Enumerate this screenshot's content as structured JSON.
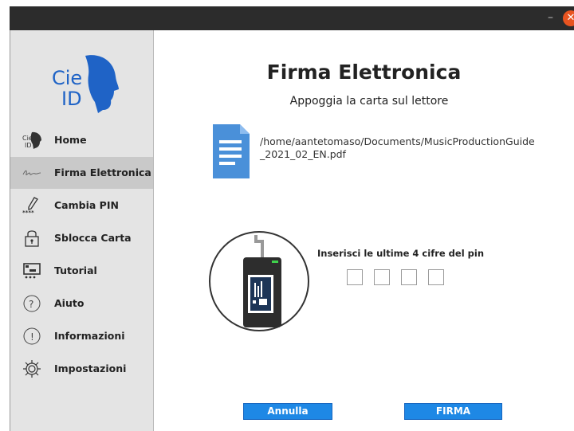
{
  "window": {
    "minimize_label": "–",
    "close_label": "✕"
  },
  "logo": {
    "line1": "Cie",
    "line2": "ID",
    "brand_color": "#1f63c6"
  },
  "sidebar": {
    "items": [
      {
        "label": "Home",
        "icon": "cie-id-icon",
        "active": false
      },
      {
        "label": "Firma Elettronica",
        "icon": "signature-icon",
        "active": true
      },
      {
        "label": "Cambia PIN",
        "icon": "pen-pin-icon",
        "active": false
      },
      {
        "label": "Sblocca Carta",
        "icon": "padlock-icon",
        "active": false
      },
      {
        "label": "Tutorial",
        "icon": "tutorial-icon",
        "active": false
      },
      {
        "label": "Aiuto",
        "icon": "question-icon",
        "active": false
      },
      {
        "label": "Informazioni",
        "icon": "exclamation-icon",
        "active": false
      },
      {
        "label": "Impostazioni",
        "icon": "gear-icon",
        "active": false
      }
    ]
  },
  "main": {
    "title": "Firma Elettronica",
    "subtitle": "Appoggia la carta sul lettore",
    "file_path": "/home/aantetomaso/Documents/MusicProductionGuide_2021_02_EN.pdf",
    "pin_label": "Inserisci le ultime 4 cifre del pin",
    "pin_values": [
      "",
      "",
      "",
      ""
    ],
    "cancel_label": "Annulla",
    "sign_label": "FIRMA"
  },
  "colors": {
    "titlebar": "#2c2c2c",
    "sidebar_bg": "#e4e4e4",
    "sidebar_active": "#c9c9c9",
    "button_blue": "#1e88e5",
    "close_orange": "#e95420",
    "file_icon_blue": "#4a90d9"
  }
}
